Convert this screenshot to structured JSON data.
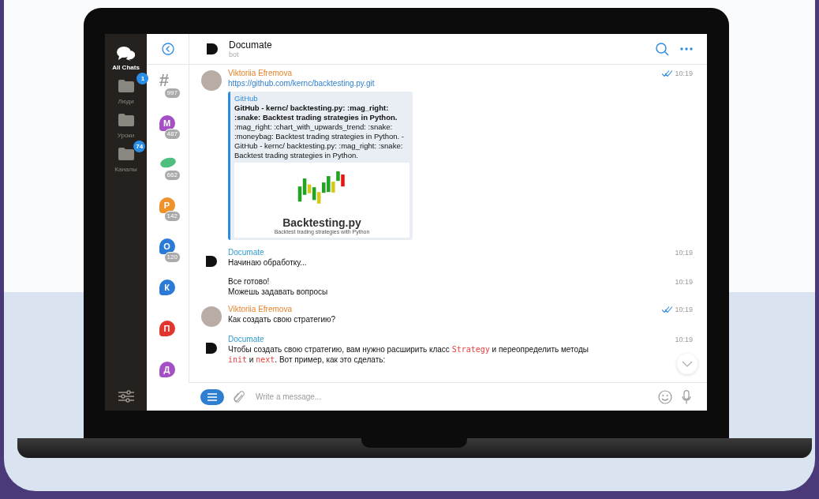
{
  "folders": [
    {
      "label": "All Chats",
      "kind": "chats",
      "selected": true
    },
    {
      "label": "Люди",
      "kind": "folder",
      "badge": "1",
      "selected": false
    },
    {
      "label": "Уроки",
      "kind": "folder",
      "selected": false
    },
    {
      "label": "Каналы",
      "kind": "folder",
      "badge": "74",
      "selected": false
    }
  ],
  "chats": [
    {
      "kind": "hash",
      "letter": "#",
      "color": "#9a9a9a",
      "count": "997"
    },
    {
      "kind": "letter",
      "letter": "М",
      "color": "#a54fc4",
      "count": "487"
    },
    {
      "kind": "pill",
      "color": "#4fbf7f",
      "count": "662"
    },
    {
      "kind": "letter",
      "letter": "Р",
      "color": "#f0922a",
      "count": "142"
    },
    {
      "kind": "letter",
      "letter": "О",
      "color": "#2b7ad6",
      "count": "120"
    },
    {
      "kind": "letter",
      "letter": "К",
      "color": "#2b7ad6"
    },
    {
      "kind": "letter",
      "letter": "П",
      "color": "#e0362c"
    },
    {
      "kind": "letter",
      "letter": "Д",
      "color": "#a54fc4"
    }
  ],
  "header": {
    "title": "Documate",
    "subtitle": "bot"
  },
  "messages": [
    {
      "kind": "user",
      "author": "Viktoriia Efremova",
      "time": "10:19",
      "read": true,
      "parts": [
        {
          "text": "https://github.com/kernc/backtesting.py.git",
          "kind": "link"
        }
      ],
      "preview": {
        "site": "GitHub",
        "title": "GitHub - kernc/ backtesting.py: :mag_right: :snake: Backtest trading strategies in Python.",
        "description": ":mag_right: :chart_with_upwards_trend: :snake: :moneybag:  Backtest trading strategies in Python. - GitHub - kernc/ backtesting.py: :mag_right: :snake: Backtest trading strategies in Python.",
        "image_title": "Backtesting.py",
        "image_subtitle": "Backtest trading strategies with Python"
      }
    },
    {
      "kind": "bot",
      "author": "Documate",
      "time": "10:19",
      "parts": [
        {
          "text": "Начинаю обработку...",
          "kind": "text"
        }
      ]
    },
    {
      "time": "10:19",
      "parts": [
        {
          "text": "Все готово!\nМожешь задавать вопросы",
          "kind": "text"
        }
      ]
    },
    {
      "kind": "user",
      "author": "Viktoriia Efremova",
      "time": "10:19",
      "read": true,
      "parts": [
        {
          "text": "Как создать свою стратегию?",
          "kind": "text"
        }
      ]
    },
    {
      "kind": "bot",
      "author": "Documate",
      "time": "10:19",
      "parts": [
        {
          "text": "Чтобы создать свою стратегию, вам нужно расширить класс ",
          "kind": "text"
        },
        {
          "text": "Strategy",
          "kind": "code"
        },
        {
          "text": " и переопределить методы\n",
          "kind": "text"
        },
        {
          "text": "init",
          "kind": "code"
        },
        {
          "text": " и ",
          "kind": "text"
        },
        {
          "text": "next",
          "kind": "code"
        },
        {
          "text": ". Вот пример, как это сделать:",
          "kind": "text"
        }
      ]
    }
  ],
  "composer": {
    "placeholder": "Write a message..."
  }
}
